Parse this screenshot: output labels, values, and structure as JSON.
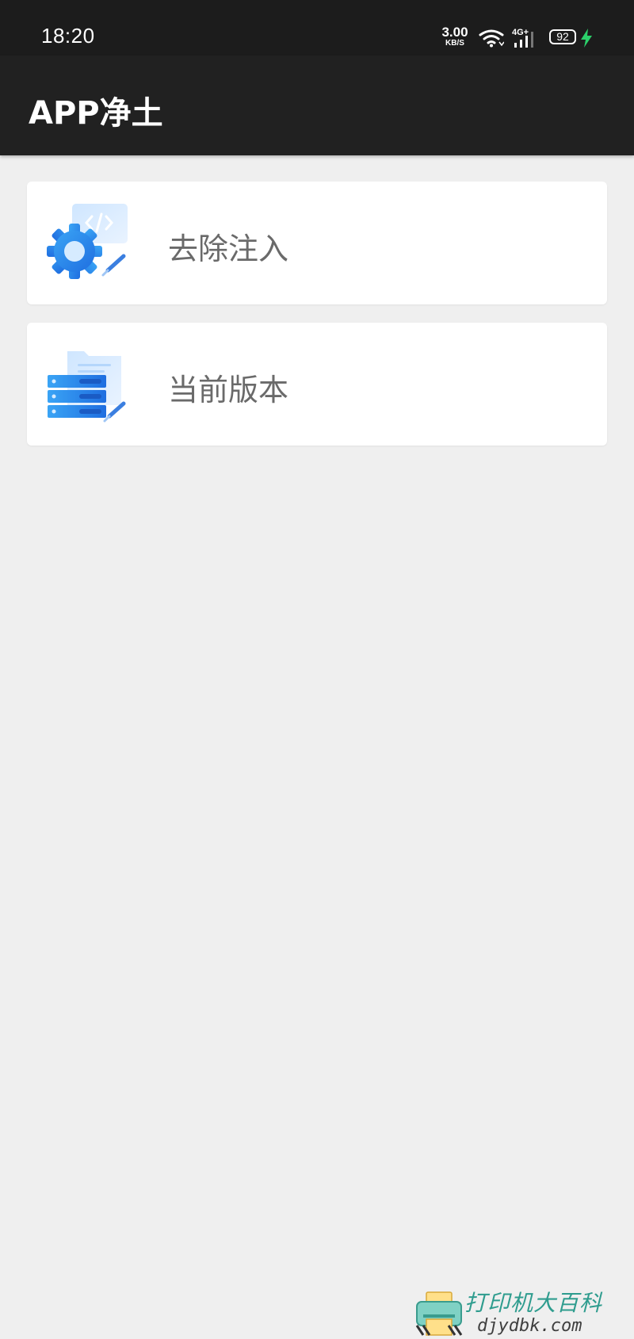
{
  "status_bar": {
    "time": "18:20",
    "net_speed_value": "3.00",
    "net_speed_unit": "KB/S",
    "network_type": "4G+",
    "battery_level": "92",
    "icons": [
      "wifi-icon",
      "signal-icon",
      "battery-icon",
      "charging-bolt-icon"
    ]
  },
  "app_bar": {
    "title": "APP净土"
  },
  "menu": {
    "items": [
      {
        "label": "去除注入",
        "icon": "gear-code-icon"
      },
      {
        "label": "当前版本",
        "icon": "server-folder-icon"
      }
    ]
  },
  "watermark": {
    "cn": "打印机大百科",
    "url": "djydbk.com"
  },
  "colors": {
    "status_bar_bg": "#1c1c1c",
    "app_bar_bg": "#212121",
    "page_bg": "#efefef",
    "card_bg": "#ffffff",
    "label_text": "#6a6a6a",
    "icon_blue": "#2f8cf0",
    "charging_green": "#2bd06a"
  }
}
